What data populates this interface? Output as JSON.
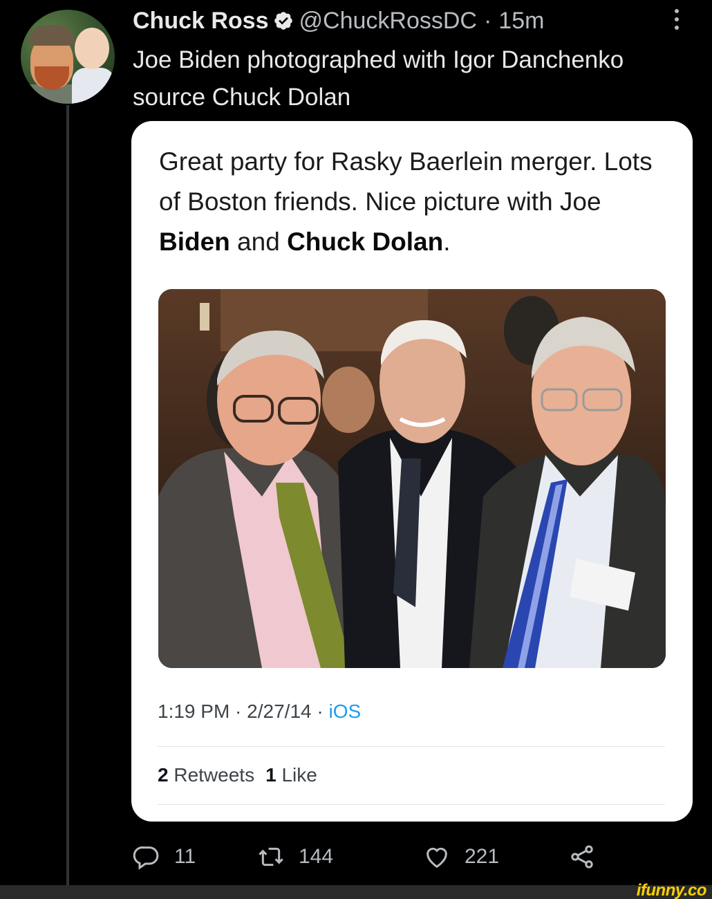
{
  "author": {
    "name": "Chuck Ross",
    "handle": "@ChuckRossDC",
    "separator": "·",
    "time_ago": "15m"
  },
  "tweet": {
    "text": "Joe Biden photographed with Igor Danchenko source Chuck Dolan"
  },
  "quoted": {
    "text_part1": "Great party for Rasky Baerlein merger. Lots of Boston friends. Nice picture with Joe ",
    "bold1": "Biden",
    "text_part2": " and ",
    "bold2": "Chuck Dolan",
    "text_part3": ".",
    "time": "1:19 PM",
    "date": "2/27/14",
    "source": "iOS",
    "meta_sep": " · ",
    "retweets_count": "2",
    "retweets_label": "Retweets",
    "likes_count": "1",
    "likes_label": "Like"
  },
  "actions": {
    "replies": "11",
    "retweets": "144",
    "likes": "221"
  },
  "colors": {
    "accent": "#1d9bf0",
    "background": "#000000",
    "card": "#ffffff",
    "watermark": "#f7d000"
  },
  "icons": [
    "verified-badge-icon",
    "more-icon",
    "reply-icon",
    "retweet-icon",
    "like-icon",
    "share-icon"
  ],
  "watermark": "ifunny.co"
}
